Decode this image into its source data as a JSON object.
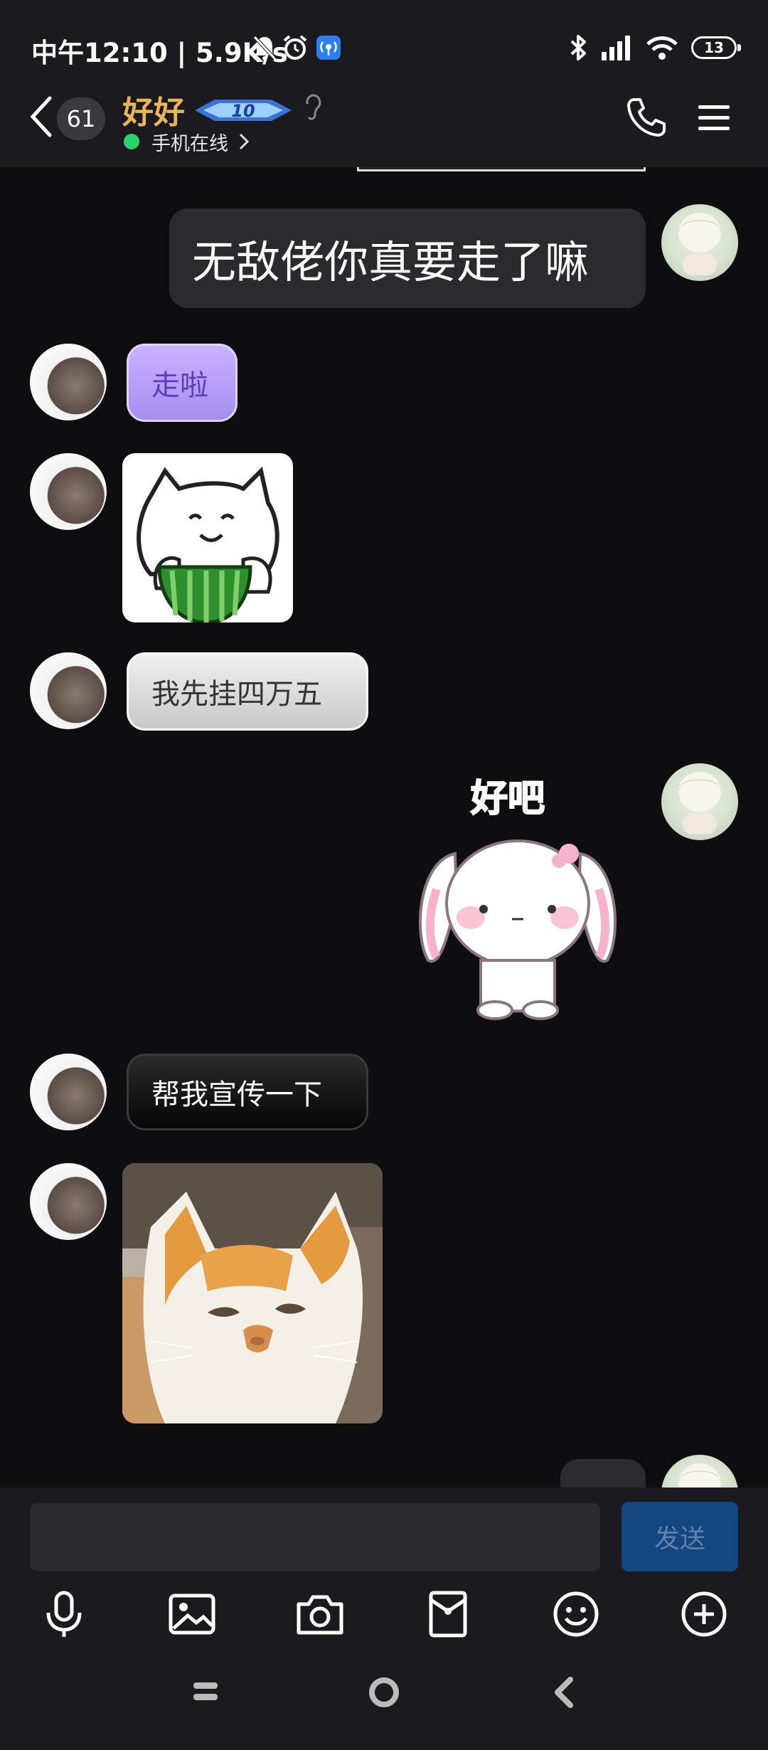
{
  "status_bar": {
    "time_speed": "中午12:10 | 5.9K/s",
    "battery": "13"
  },
  "header": {
    "unread_count": "61",
    "contact_name": "好好",
    "level": "10",
    "online_status": "手机在线"
  },
  "messages": [
    {
      "side": "self",
      "text": "无敌佬你真要走了嘛"
    },
    {
      "side": "other",
      "text": "走啦",
      "style": "purple"
    },
    {
      "side": "other",
      "sticker": "cat-melon-sticker"
    },
    {
      "side": "other",
      "text": "我先挂四万五",
      "style": "grey"
    },
    {
      "side": "self",
      "sticker": "bunny-sticker",
      "sticker_text": "好吧"
    },
    {
      "side": "other",
      "text": "帮我宣传一下",
      "style": "black"
    },
    {
      "side": "other",
      "sticker": "cat-photo"
    }
  ],
  "input": {
    "placeholder": "",
    "send_label": "发送"
  },
  "colors": {
    "background": "#0e0e10",
    "name": "#e9b45a",
    "send_button": "#14467f"
  }
}
